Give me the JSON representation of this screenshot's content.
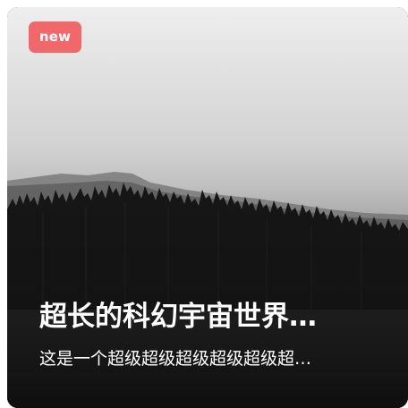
{
  "card": {
    "badge": "new",
    "title": "超长的科幻宇宙世界…",
    "subtitle": "这是一个超级超级超级超级超级超…",
    "image_icon": "forest-landscape-image"
  },
  "colors": {
    "badge_bg": "#f0686a",
    "text": "#ffffff",
    "sky_top": "#e6e6e6",
    "sky_bottom": "#a8a8a8",
    "forest": "#151515"
  }
}
